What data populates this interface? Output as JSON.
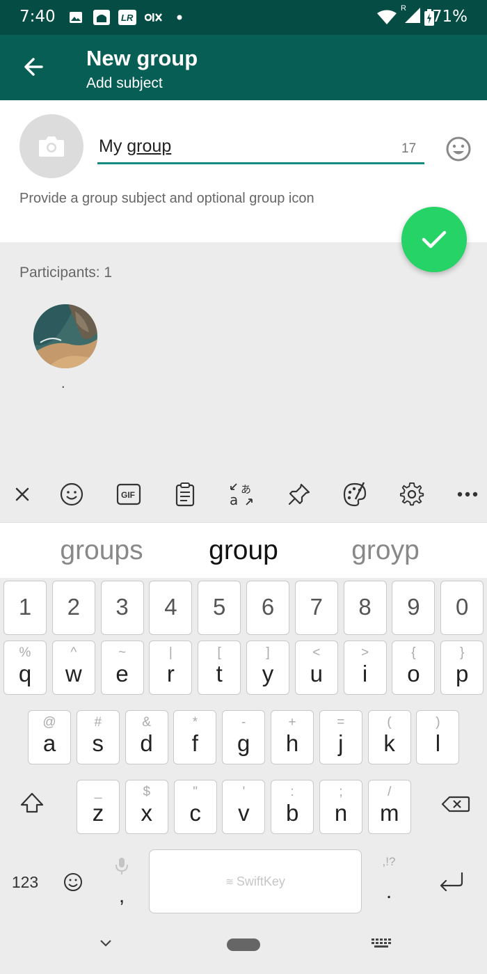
{
  "status_bar": {
    "time": "7:40",
    "battery": "71%"
  },
  "app_bar": {
    "title": "New group",
    "subtitle": "Add subject"
  },
  "subject": {
    "value_plain": "My ",
    "value_underlined": "group",
    "char_count": "17",
    "hint": "Provide a group subject and optional group icon"
  },
  "participants": {
    "label": "Participants: 1",
    "items": [
      {
        "name": "."
      }
    ]
  },
  "keyboard": {
    "suggestions": [
      "groups",
      "group",
      "groyp"
    ],
    "number_row": [
      "1",
      "2",
      "3",
      "4",
      "5",
      "6",
      "7",
      "8",
      "9",
      "0"
    ],
    "row1": [
      {
        "main": "q",
        "alt": "%"
      },
      {
        "main": "w",
        "alt": "^"
      },
      {
        "main": "e",
        "alt": "~"
      },
      {
        "main": "r",
        "alt": "|"
      },
      {
        "main": "t",
        "alt": "["
      },
      {
        "main": "y",
        "alt": "]"
      },
      {
        "main": "u",
        "alt": "<"
      },
      {
        "main": "i",
        "alt": ">"
      },
      {
        "main": "o",
        "alt": "{"
      },
      {
        "main": "p",
        "alt": "}"
      }
    ],
    "row2": [
      {
        "main": "a",
        "alt": "@"
      },
      {
        "main": "s",
        "alt": "#"
      },
      {
        "main": "d",
        "alt": "&"
      },
      {
        "main": "f",
        "alt": "*"
      },
      {
        "main": "g",
        "alt": "-"
      },
      {
        "main": "h",
        "alt": "+"
      },
      {
        "main": "j",
        "alt": "="
      },
      {
        "main": "k",
        "alt": "("
      },
      {
        "main": "l",
        "alt": ")"
      }
    ],
    "row3": [
      {
        "main": "z",
        "alt": "_"
      },
      {
        "main": "x",
        "alt": "$"
      },
      {
        "main": "c",
        "alt": "\""
      },
      {
        "main": "v",
        "alt": "'"
      },
      {
        "main": "b",
        "alt": ":"
      },
      {
        "main": "n",
        "alt": ";"
      },
      {
        "main": "m",
        "alt": "/"
      }
    ],
    "numbers_key": "123",
    "comma_key": ",",
    "period_key": ".",
    "period_alt": ",!?",
    "space_brand": "SwiftKey",
    "toolbar_gif": "GIF"
  },
  "colors": {
    "status_bar": "#054d44",
    "app_bar": "#075e54",
    "accent": "#128c7e",
    "fab": "#25d366"
  }
}
